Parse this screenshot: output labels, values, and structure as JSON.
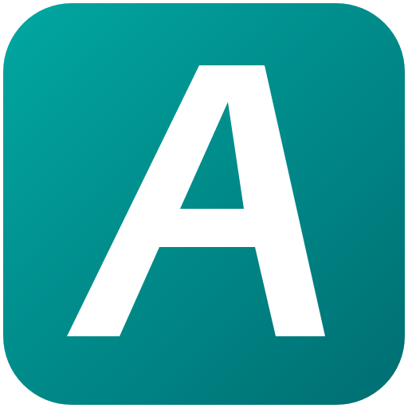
{
  "icon": {
    "name": "app-icon-letter-a",
    "glyph": "A",
    "colors": {
      "gradient_start": "#01A7A1",
      "gradient_end": "#006E72",
      "glyph": "#FFFFFF",
      "background": "#FFFFFF"
    }
  }
}
